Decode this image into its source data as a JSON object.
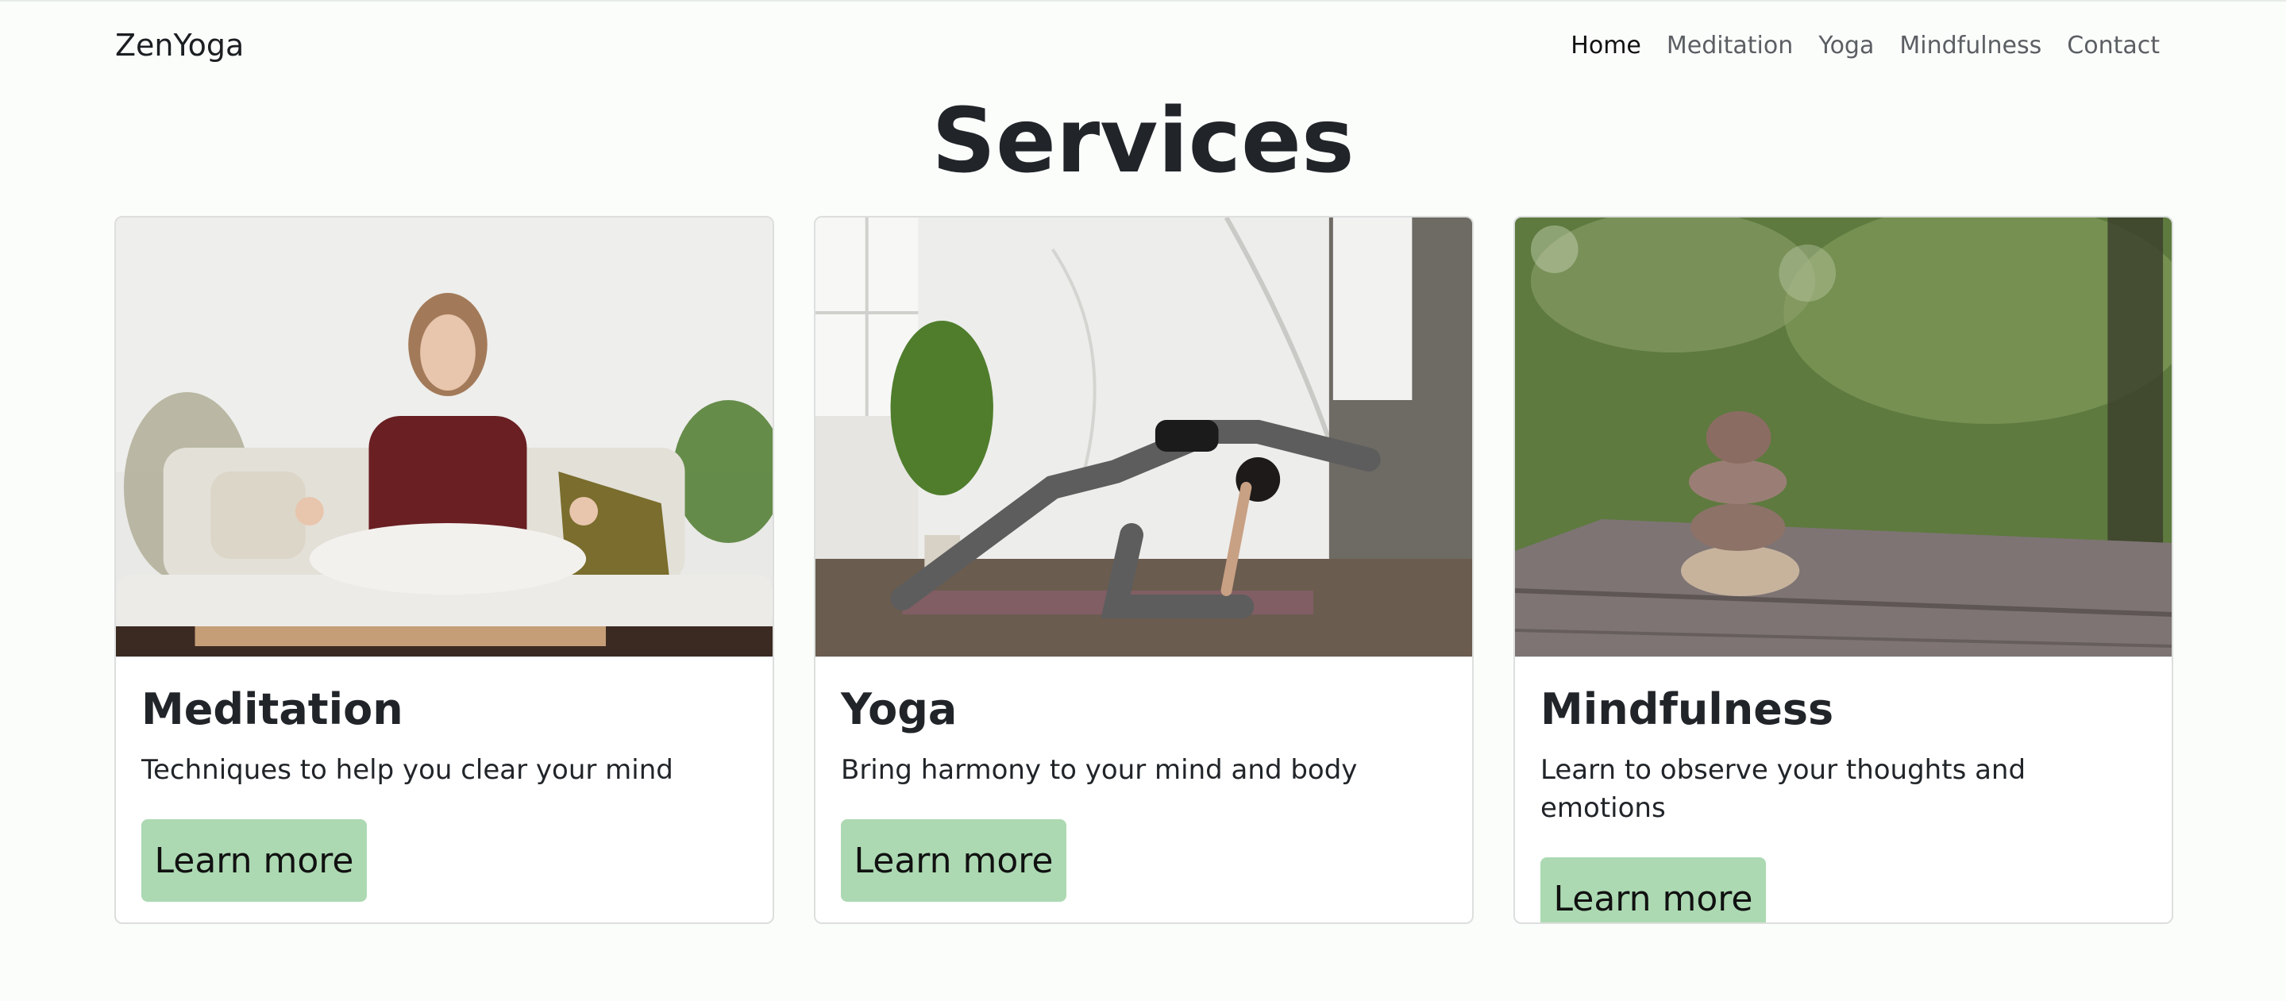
{
  "brand": "ZenYoga",
  "nav": [
    {
      "label": "Home",
      "active": true
    },
    {
      "label": "Meditation",
      "active": false
    },
    {
      "label": "Yoga",
      "active": false
    },
    {
      "label": "Mindfulness",
      "active": false
    },
    {
      "label": "Contact",
      "active": false
    }
  ],
  "page": {
    "title": "Services"
  },
  "cards": [
    {
      "title": "Meditation",
      "text": "Techniques to help you clear your mind",
      "button": "Learn more"
    },
    {
      "title": "Yoga",
      "text": "Bring harmony to your mind and body",
      "button": "Learn more"
    },
    {
      "title": "Mindfulness",
      "text": "Learn to observe your thoughts and emotions",
      "button": "Learn more"
    }
  ],
  "colors": {
    "button": "#acd9b2",
    "background": "#fbfdfb"
  }
}
